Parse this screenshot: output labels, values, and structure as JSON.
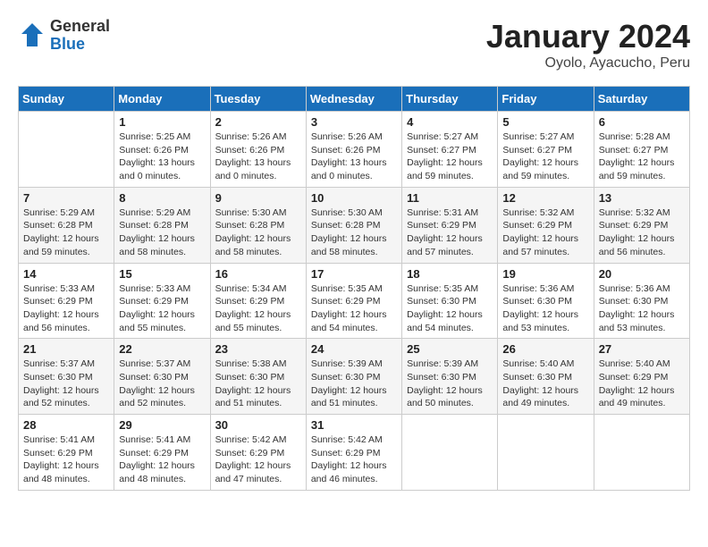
{
  "header": {
    "logo_general": "General",
    "logo_blue": "Blue",
    "title": "January 2024",
    "location": "Oyolo, Ayacucho, Peru"
  },
  "days_of_week": [
    "Sunday",
    "Monday",
    "Tuesday",
    "Wednesday",
    "Thursday",
    "Friday",
    "Saturday"
  ],
  "weeks": [
    [
      {
        "day": "",
        "info": ""
      },
      {
        "day": "1",
        "info": "Sunrise: 5:25 AM\nSunset: 6:26 PM\nDaylight: 13 hours\nand 0 minutes."
      },
      {
        "day": "2",
        "info": "Sunrise: 5:26 AM\nSunset: 6:26 PM\nDaylight: 13 hours\nand 0 minutes."
      },
      {
        "day": "3",
        "info": "Sunrise: 5:26 AM\nSunset: 6:26 PM\nDaylight: 13 hours\nand 0 minutes."
      },
      {
        "day": "4",
        "info": "Sunrise: 5:27 AM\nSunset: 6:27 PM\nDaylight: 12 hours\nand 59 minutes."
      },
      {
        "day": "5",
        "info": "Sunrise: 5:27 AM\nSunset: 6:27 PM\nDaylight: 12 hours\nand 59 minutes."
      },
      {
        "day": "6",
        "info": "Sunrise: 5:28 AM\nSunset: 6:27 PM\nDaylight: 12 hours\nand 59 minutes."
      }
    ],
    [
      {
        "day": "7",
        "info": "Sunrise: 5:29 AM\nSunset: 6:28 PM\nDaylight: 12 hours\nand 59 minutes."
      },
      {
        "day": "8",
        "info": "Sunrise: 5:29 AM\nSunset: 6:28 PM\nDaylight: 12 hours\nand 58 minutes."
      },
      {
        "day": "9",
        "info": "Sunrise: 5:30 AM\nSunset: 6:28 PM\nDaylight: 12 hours\nand 58 minutes."
      },
      {
        "day": "10",
        "info": "Sunrise: 5:30 AM\nSunset: 6:28 PM\nDaylight: 12 hours\nand 58 minutes."
      },
      {
        "day": "11",
        "info": "Sunrise: 5:31 AM\nSunset: 6:29 PM\nDaylight: 12 hours\nand 57 minutes."
      },
      {
        "day": "12",
        "info": "Sunrise: 5:32 AM\nSunset: 6:29 PM\nDaylight: 12 hours\nand 57 minutes."
      },
      {
        "day": "13",
        "info": "Sunrise: 5:32 AM\nSunset: 6:29 PM\nDaylight: 12 hours\nand 56 minutes."
      }
    ],
    [
      {
        "day": "14",
        "info": "Sunrise: 5:33 AM\nSunset: 6:29 PM\nDaylight: 12 hours\nand 56 minutes."
      },
      {
        "day": "15",
        "info": "Sunrise: 5:33 AM\nSunset: 6:29 PM\nDaylight: 12 hours\nand 55 minutes."
      },
      {
        "day": "16",
        "info": "Sunrise: 5:34 AM\nSunset: 6:29 PM\nDaylight: 12 hours\nand 55 minutes."
      },
      {
        "day": "17",
        "info": "Sunrise: 5:35 AM\nSunset: 6:29 PM\nDaylight: 12 hours\nand 54 minutes."
      },
      {
        "day": "18",
        "info": "Sunrise: 5:35 AM\nSunset: 6:30 PM\nDaylight: 12 hours\nand 54 minutes."
      },
      {
        "day": "19",
        "info": "Sunrise: 5:36 AM\nSunset: 6:30 PM\nDaylight: 12 hours\nand 53 minutes."
      },
      {
        "day": "20",
        "info": "Sunrise: 5:36 AM\nSunset: 6:30 PM\nDaylight: 12 hours\nand 53 minutes."
      }
    ],
    [
      {
        "day": "21",
        "info": "Sunrise: 5:37 AM\nSunset: 6:30 PM\nDaylight: 12 hours\nand 52 minutes."
      },
      {
        "day": "22",
        "info": "Sunrise: 5:37 AM\nSunset: 6:30 PM\nDaylight: 12 hours\nand 52 minutes."
      },
      {
        "day": "23",
        "info": "Sunrise: 5:38 AM\nSunset: 6:30 PM\nDaylight: 12 hours\nand 51 minutes."
      },
      {
        "day": "24",
        "info": "Sunrise: 5:39 AM\nSunset: 6:30 PM\nDaylight: 12 hours\nand 51 minutes."
      },
      {
        "day": "25",
        "info": "Sunrise: 5:39 AM\nSunset: 6:30 PM\nDaylight: 12 hours\nand 50 minutes."
      },
      {
        "day": "26",
        "info": "Sunrise: 5:40 AM\nSunset: 6:30 PM\nDaylight: 12 hours\nand 49 minutes."
      },
      {
        "day": "27",
        "info": "Sunrise: 5:40 AM\nSunset: 6:29 PM\nDaylight: 12 hours\nand 49 minutes."
      }
    ],
    [
      {
        "day": "28",
        "info": "Sunrise: 5:41 AM\nSunset: 6:29 PM\nDaylight: 12 hours\nand 48 minutes."
      },
      {
        "day": "29",
        "info": "Sunrise: 5:41 AM\nSunset: 6:29 PM\nDaylight: 12 hours\nand 48 minutes."
      },
      {
        "day": "30",
        "info": "Sunrise: 5:42 AM\nSunset: 6:29 PM\nDaylight: 12 hours\nand 47 minutes."
      },
      {
        "day": "31",
        "info": "Sunrise: 5:42 AM\nSunset: 6:29 PM\nDaylight: 12 hours\nand 46 minutes."
      },
      {
        "day": "",
        "info": ""
      },
      {
        "day": "",
        "info": ""
      },
      {
        "day": "",
        "info": ""
      }
    ]
  ]
}
